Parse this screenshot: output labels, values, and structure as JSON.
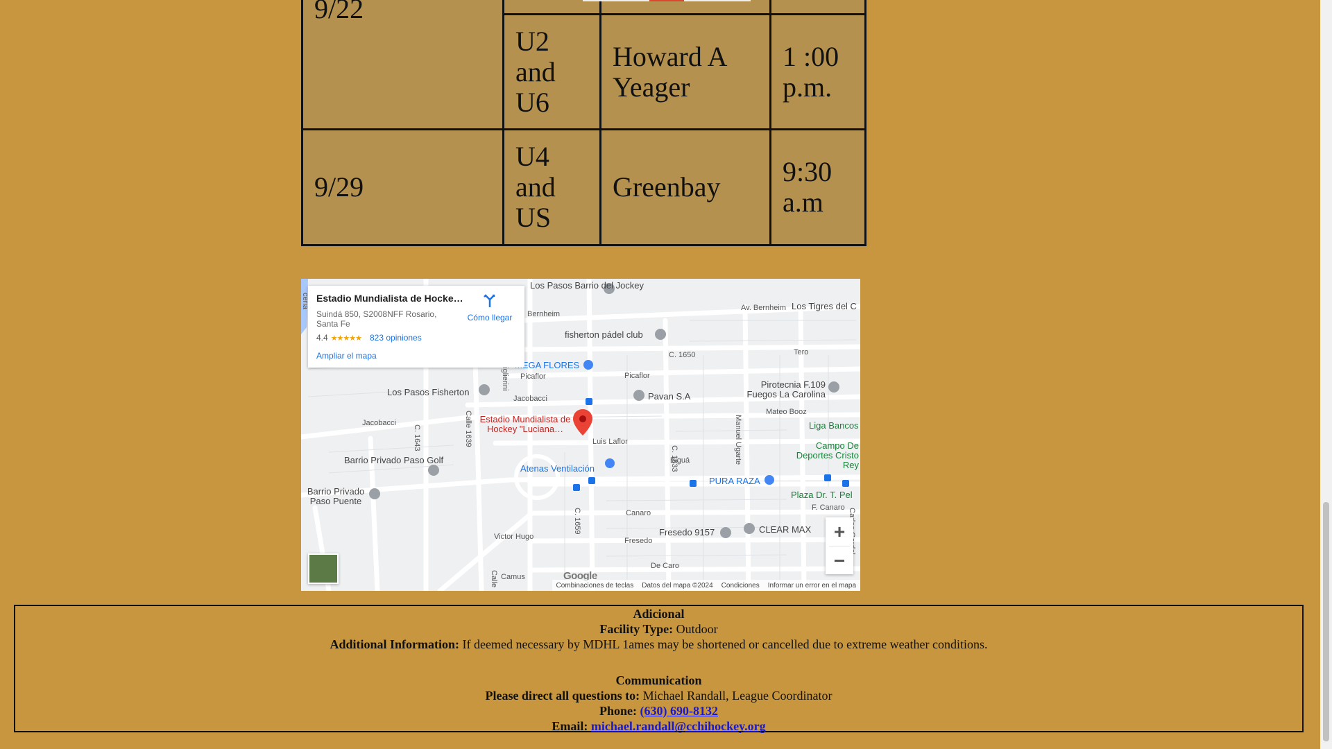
{
  "schedule": {
    "rows": [
      {
        "date": "9/22",
        "group": "",
        "location": "",
        "time": ""
      },
      {
        "date": "",
        "group": "U2 and U6",
        "location": "Howard A Yeager",
        "time": "1 :00 p.m."
      },
      {
        "date": "9/29",
        "group": "U4 and US",
        "location": "Greenbay",
        "time": "9:30 a.m"
      }
    ]
  },
  "map": {
    "card": {
      "name": "Estadio Mundialista de Hocke…",
      "address": "Suindá 850, S2008NFF Rosario, Santa Fe",
      "rating": "4.4",
      "stars": "★★★★★",
      "reviews": "823 opiniones",
      "enlarge": "Ampliar el mapa",
      "directions": "Cómo llegar"
    },
    "labels": {
      "los_pasos_jockey": "Los Pasos Barrio del Jockey",
      "bernheim": "Bernheim",
      "av_bernheim": "Av. Bernheim",
      "los_tigres": "Los Tigres del C",
      "fisherton_padel": "fisherton pádel club",
      "c1650": "C. 1650",
      "tero": "Tero",
      "mega_flores": "MEGA FLORES",
      "picaflor": "Picaflor",
      "picaflor2": "Picaflor",
      "los_pasos_fisherton": "Los Pasos Fisherton",
      "jacobacci": "Jacobacci",
      "jacobacci2": "Jacobacci",
      "pavan": "Pavan S.A",
      "pirotecnia": "Pirotecnia F.109 Fuegos La Carolina",
      "mateo_booz": "Mateo Booz",
      "liga_bancos": "Liga Bancos",
      "estadio": "Estadio Mundialista de Hockey \"Luciana…",
      "luis_laflor": "Luis Laflor",
      "campo_de": "Campo De Deportes Cristo Rey",
      "barrio_paso_golf": "Barrio Privado Paso Golf",
      "atenas": "Atenas Ventilación",
      "bigua": "Biguá",
      "pura_raza": "PURA RAZA",
      "barrio_paso_puente": "Barrio Privado Paso Puente",
      "plaza": "Plaza Dr. T. Pel",
      "f_canaro": "F. Canaro",
      "canaro": "Canaro",
      "victor_hugo": "Victor Hugo",
      "fresedo": "Fresedo",
      "fresedo_9157": "Fresedo 9157",
      "clear_max": "CLEAR MAX",
      "de_caro": "De Caro",
      "camus": "Camus",
      "c1643": "C. 1643",
      "calle1639": "Calle 1639",
      "c1633": "C. 1633",
      "c1659": "C. 1659",
      "manuel_ugarte": "Manuel Ugarte",
      "carlos_gardel": "Carlos Gardel",
      "migliorini": "Miglierini",
      "ceria": "ceria",
      "calle": "Calle"
    },
    "google": "Google",
    "attribution": [
      "Combinaciones de teclas",
      "Datos del mapa ©2024",
      "Condiciones",
      "Informar un error en el mapa"
    ],
    "zoom_in": "+",
    "zoom_out": "−"
  },
  "footer": {
    "heading": "Adicional",
    "facility_label": "Facility Type:",
    "facility_value": "Outdoor",
    "additional_label": "Additional Information:",
    "additional_value": "If deemed necessary by MDHL 1ames may be shortened or cancelled due to extreme weather conditions.",
    "comm_heading": "Communication",
    "questions_label": "Please direct all questions to:",
    "questions_value": "Michael Randall, League Coordinator",
    "phone_label": "Phone:",
    "phone_value": "(630) 690-8132",
    "email_label": "Email:",
    "email_value": "michael.randall@cchihockey.org"
  },
  "colors": {
    "page_bg": "#c8963e",
    "table_bg": "#b5914f",
    "link": "#1a1acc"
  }
}
